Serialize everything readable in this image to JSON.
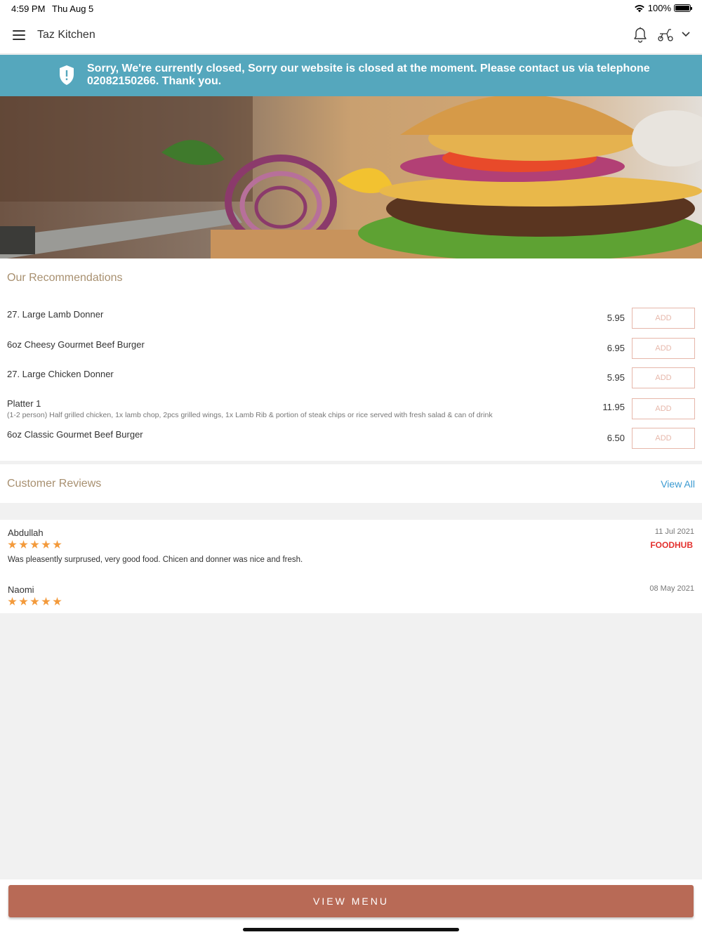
{
  "status_bar": {
    "time": "4:59 PM",
    "date": "Thu Aug 5",
    "battery": "100%"
  },
  "header": {
    "title": "Taz Kitchen",
    "icons": [
      "menu-icon",
      "bell-icon",
      "scooter-icon",
      "chevron-down-icon"
    ]
  },
  "banner": {
    "text": "Sorry, We're currently closed, Sorry our website is closed at the moment. Please contact us via telephone 02082150266. Thank you.",
    "icon": "shield-alert-icon",
    "color": "#55a7bd"
  },
  "recommendations": {
    "title": "Our Recommendations",
    "add_label": "ADD",
    "items": [
      {
        "name": "27. Large Lamb Donner",
        "description": "",
        "price": "5.95"
      },
      {
        "name": "6oz Cheesy Gourmet Beef Burger",
        "description": "",
        "price": "6.95"
      },
      {
        "name": "27. Large Chicken Donner",
        "description": "",
        "price": "5.95"
      },
      {
        "name": "Platter 1",
        "description": "(1-2 person) Half grilled chicken, 1x lamb chop, 2pcs grilled wings, 1x Lamb Rib & portion of steak chips or rice served with fresh salad & can of drink",
        "price": "11.95"
      },
      {
        "name": "6oz Classic Gourmet Beef Burger",
        "description": "",
        "price": "6.50"
      }
    ]
  },
  "reviews": {
    "title": "Customer Reviews",
    "view_all": "View All",
    "items": [
      {
        "name": "Abdullah",
        "date": "11 Jul 2021",
        "rating": 5,
        "source": "FOODHUB",
        "text": "Was pleasently surprused, very good food. Chicen and donner was nice and fresh."
      },
      {
        "name": "Naomi",
        "date": "08 May 2021",
        "rating": 5,
        "source": "",
        "text": ""
      }
    ]
  },
  "footer": {
    "button": "VIEW MENU"
  },
  "colors": {
    "accent": "#b86a56",
    "banner": "#55a7bd",
    "section_title": "#a89070",
    "star": "#f39a3b",
    "link": "#3a9ad1"
  }
}
